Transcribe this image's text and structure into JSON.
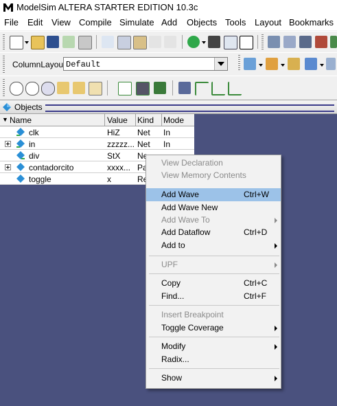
{
  "app": {
    "title": "ModelSim ALTERA STARTER EDITION 10.3c"
  },
  "menubar": {
    "items": [
      {
        "label": "File"
      },
      {
        "label": "Edit"
      },
      {
        "label": "View"
      },
      {
        "label": "Compile"
      },
      {
        "label": "Simulate"
      },
      {
        "label": "Add"
      },
      {
        "label": "Objects"
      },
      {
        "label": "Tools"
      },
      {
        "label": "Layout"
      },
      {
        "label": "Bookmarks"
      }
    ]
  },
  "layout_toolbar": {
    "label": "ColumnLayout",
    "value": "Default"
  },
  "objects_panel": {
    "title": "Objects",
    "columns": [
      "Name",
      "Value",
      "Kind",
      "Mode"
    ],
    "rows": [
      {
        "name": "clk",
        "value": "HiZ",
        "kind": "Net",
        "mode": "In"
      },
      {
        "name": "in",
        "value": "zzzzz...",
        "kind": "Net",
        "mode": "In"
      },
      {
        "name": "div",
        "value": "StX",
        "kind": "Ne",
        "mode": ""
      },
      {
        "name": "contadorcito",
        "value": "xxxx...",
        "kind": "Pa",
        "mode": ""
      },
      {
        "name": "toggle",
        "value": "x",
        "kind": "Re",
        "mode": ""
      }
    ]
  },
  "context_menu": {
    "items": [
      {
        "label": "View Declaration",
        "shortcut": "",
        "submenu": false,
        "disabled": true
      },
      {
        "label": "View Memory Contents",
        "shortcut": "",
        "submenu": false,
        "disabled": true
      },
      {
        "label": "Add Wave",
        "shortcut": "Ctrl+W",
        "submenu": false,
        "disabled": false,
        "highlighted": true
      },
      {
        "label": "Add Wave New",
        "shortcut": "",
        "submenu": false,
        "disabled": false
      },
      {
        "label": "Add Wave To",
        "shortcut": "",
        "submenu": true,
        "disabled": true
      },
      {
        "label": "Add Dataflow",
        "shortcut": "Ctrl+D",
        "submenu": false,
        "disabled": false
      },
      {
        "label": "Add to",
        "shortcut": "",
        "submenu": true,
        "disabled": false
      },
      {
        "label": "UPF",
        "shortcut": "",
        "submenu": true,
        "disabled": true
      },
      {
        "label": "Copy",
        "shortcut": "Ctrl+C",
        "submenu": false,
        "disabled": false
      },
      {
        "label": "Find...",
        "shortcut": "Ctrl+F",
        "submenu": false,
        "disabled": false
      },
      {
        "label": "Insert Breakpoint",
        "shortcut": "",
        "submenu": false,
        "disabled": true
      },
      {
        "label": "Toggle Coverage",
        "shortcut": "",
        "submenu": true,
        "disabled": false
      },
      {
        "label": "Modify",
        "shortcut": "",
        "submenu": true,
        "disabled": false
      },
      {
        "label": "Radix...",
        "shortcut": "",
        "submenu": false,
        "disabled": false
      },
      {
        "label": "Show",
        "shortcut": "",
        "submenu": true,
        "disabled": false
      }
    ]
  },
  "colors": {
    "pane_background": "#4a517e",
    "menu_highlight": "#9cc2e8",
    "signal_icon": "#2a8fd6"
  }
}
